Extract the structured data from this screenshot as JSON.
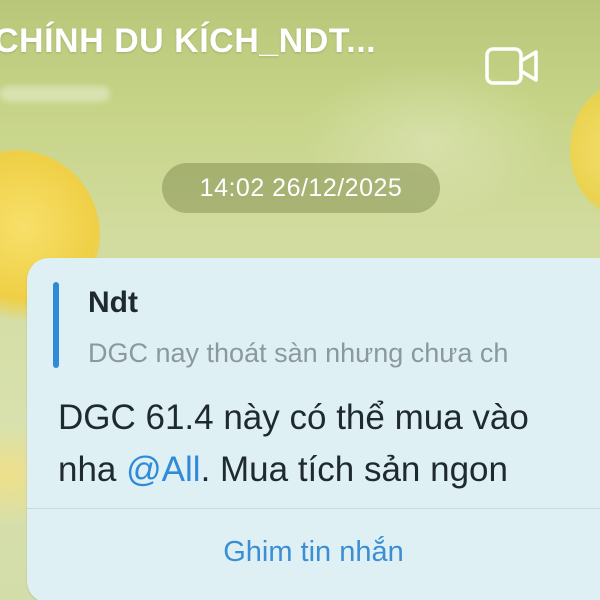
{
  "header": {
    "title": "CHÍNH DU KÍCH_NDT...",
    "video_call_icon": "video-camera-icon"
  },
  "date_chip": {
    "label": "14:02 26/12/2025"
  },
  "message": {
    "reply": {
      "author": "Ndt",
      "text": "DGC nay thoát sàn nhưng chưa ch"
    },
    "line1": "DGC 61.4 này có thể mua vào",
    "line2_prefix": "nha ",
    "mention": "@All",
    "line2_suffix": ". Mua tích sản ngon",
    "action_label": "Ghim tin nhắn"
  },
  "colors": {
    "accent": "#2f8bd8",
    "bubble": "#dff0f5",
    "reply_bar": "#2f8bd8"
  }
}
